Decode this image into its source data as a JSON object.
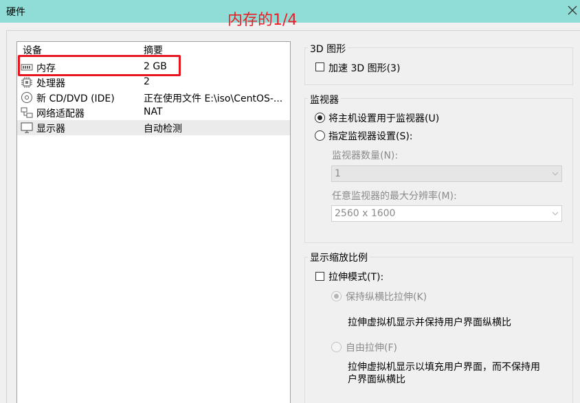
{
  "window": {
    "title": "硬件"
  },
  "annotation": "内存的1/4",
  "device_list": {
    "headers": {
      "device": "设备",
      "summary": "摘要"
    },
    "rows": [
      {
        "name": "内存",
        "summary": "2 GB",
        "icon": "memory-icon"
      },
      {
        "name": "处理器",
        "summary": "2",
        "icon": "processor-icon"
      },
      {
        "name": "新 CD/DVD (IDE)",
        "summary": "正在使用文件 E:\\iso\\CentOS-...",
        "icon": "cd-dvd-icon"
      },
      {
        "name": "网络适配器",
        "summary": "NAT",
        "icon": "network-icon"
      },
      {
        "name": "显示器",
        "summary": "自动检测",
        "icon": "display-icon",
        "selected": true
      }
    ]
  },
  "graphics_3d": {
    "title": "3D 图形",
    "accelerate_label": "加速 3D 图形(3)",
    "accelerate_checked": false
  },
  "monitor": {
    "title": "监视器",
    "use_host_label": "将主机设置用于监视器(U)",
    "specify_label": "指定监视器设置(S):",
    "selected": "use_host",
    "count_label": "监视器数量(N):",
    "count_value": "1",
    "max_res_label": "任意监视器的最大分辨率(M):",
    "max_res_value": "2560 x 1600"
  },
  "scaling": {
    "title": "显示缩放比例",
    "stretch_label": "拉伸模式(T):",
    "stretch_checked": false,
    "keep_aspect_label": "保持纵横比拉伸(K)",
    "keep_aspect_desc": "拉伸虚拟机显示并保持用户界面纵横比",
    "free_stretch_label": "自由拉伸(F)",
    "free_stretch_desc_line1": "拉伸虚拟机显示以填充用户界面，而不保持用",
    "free_stretch_desc_line2": "户界面纵横比"
  },
  "colors": {
    "titlebar": "#8fddd6",
    "annotation": "#ec1c24",
    "selected_row": "#ebebeb"
  }
}
